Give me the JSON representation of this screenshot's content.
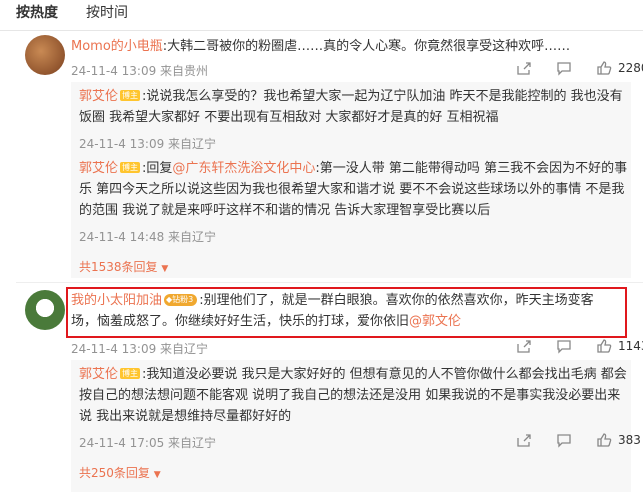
{
  "tabs": {
    "hot": "按热度",
    "time": "按时间"
  },
  "comments": [
    {
      "user": "Momo的小电瓶",
      "text": ":大韩二哥被你的粉圈虐……真的令人心寒。你竟然很享受这种欢呼……",
      "meta": "24-11-4 13:09 来自贵州",
      "likes": "2280",
      "replies": [
        {
          "user": "郭艾伦",
          "badge": "博主",
          "text": ":说说我怎么享受的？我也希望大家一起为辽宁队加油 昨天不是我能控制的 我也没有饭圈 我希望大家都好 不要出现有互相敌对 大家都好才是真的好 互相祝福",
          "meta": "24-11-4 13:09 来自辽宁"
        },
        {
          "user": "郭艾伦",
          "badge": "博主",
          "prefix": ":回复",
          "mention": "@广东轩杰洗浴文化中心",
          "text": ":第一没人带 第二能带得动吗 第三我不会因为不好的事乐 第四今天之所以说这些因为我也很希望大家和谐才说 要不不会说这些球场以外的事情 不是我的范围 我说了就是来呼吁这样不和谐的情况 告诉大家理智享受比赛以后",
          "meta": "24-11-4 14:48 来自辽宁"
        }
      ],
      "more": "共1538条回复"
    },
    {
      "user": "我的小太阳加油",
      "badge": "钻粉3",
      "text": ":别理他们了，就是一群白眼狼。喜欢你的依然喜欢你，昨天主场变客场，恼羞成怒了。你继续好好生活，快乐的打球，爱你依旧",
      "mention": "@郭文伦",
      "meta": "24-11-4 13:09 来自辽宁",
      "likes": "1143",
      "replies": [
        {
          "user": "郭艾伦",
          "badge": "博主",
          "text": ":我知道没必要说 我只是大家好好的 但想有意见的人不管你做什么都会找出毛病 都会按自己的想法想问题不能客观 说明了我自己的想法还是没用 如果我说的不是事实我没必要出来说 我出来说就是想维持尽量都好好的",
          "meta": "24-11-4 17:05 来自辽宁",
          "likes": "383"
        }
      ],
      "more": "共250条回复"
    }
  ],
  "icons": [
    "share-icon",
    "comment-icon",
    "like-icon"
  ],
  "colors": {
    "accent": "#eb7350",
    "highlight": "#e0181d",
    "badge": "#ffc52e"
  }
}
